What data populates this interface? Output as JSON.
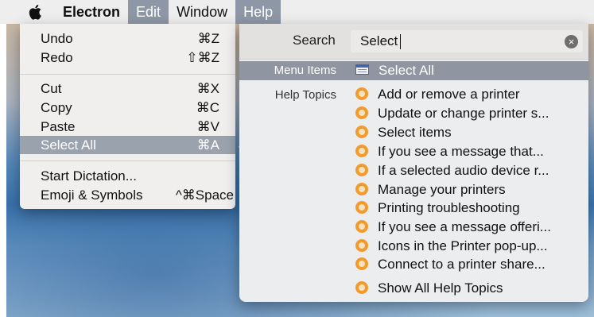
{
  "menubar": {
    "app_name": "Electron",
    "items": [
      "Edit",
      "Window",
      "Help"
    ]
  },
  "edit_menu": {
    "items": [
      {
        "label": "Undo",
        "shortcut": "⌘Z"
      },
      {
        "label": "Redo",
        "shortcut": "⇧⌘Z"
      },
      {
        "label": "Cut",
        "shortcut": "⌘X"
      },
      {
        "label": "Copy",
        "shortcut": "⌘C"
      },
      {
        "label": "Paste",
        "shortcut": "⌘V"
      },
      {
        "label": "Select All",
        "shortcut": "⌘A"
      },
      {
        "label": "Start Dictation...",
        "shortcut": ""
      },
      {
        "label": "Emoji & Symbols",
        "shortcut": "^⌘Space"
      }
    ]
  },
  "help_panel": {
    "search_label": "Search",
    "search_value": "Select",
    "section_menu_items": "Menu Items",
    "section_help_topics": "Help Topics",
    "menu_result": "Select All",
    "help_topics": [
      "Add or remove a printer",
      "Update or change printer s...",
      "Select items",
      "If you see a message that...",
      "If a selected audio device r...",
      "Manage your printers",
      "Printing troubleshooting",
      "If you see a message offeri...",
      "Icons in the Printer pop-up...",
      "Connect to a printer share..."
    ],
    "show_all": "Show All Help Topics"
  },
  "colors": {
    "menubar_bg": "#eeeeee",
    "selection": "#9aa2ad",
    "help_icon": "#f39a2c"
  }
}
